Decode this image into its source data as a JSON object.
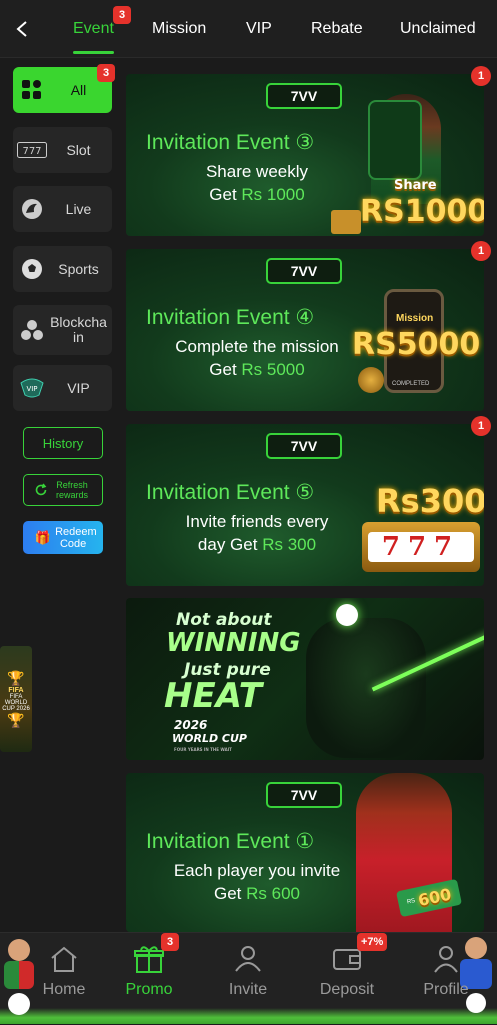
{
  "header": {
    "tabs": [
      {
        "label": "Event",
        "badge": "3",
        "active": true
      },
      {
        "label": "Mission"
      },
      {
        "label": "VIP"
      },
      {
        "label": "Rebate"
      },
      {
        "label": "Unclaimed"
      }
    ]
  },
  "sidebar": {
    "categories": [
      {
        "label": "All",
        "icon": "grid-icon",
        "badge": "3",
        "active": true
      },
      {
        "label": "Slot",
        "icon": "slot-777-icon"
      },
      {
        "label": "Live",
        "icon": "live-dealer-icon"
      },
      {
        "label": "Sports",
        "icon": "soccer-ball-icon"
      },
      {
        "label": "Blockchain",
        "icon": "blockchain-icon"
      },
      {
        "label": "VIP",
        "icon": "vip-crest-icon"
      }
    ],
    "history_label": "History",
    "refresh_label": "Refresh rewards",
    "redeem_label": "Redeem Code",
    "fifa_promo": {
      "line1": "FIFA",
      "line2": "FIFA WORLD CUP 2026"
    }
  },
  "banners": [
    {
      "brand": "7VV",
      "title": "Invitation Event ③",
      "line1": "Share weekly",
      "line2_prefix": "Get ",
      "line2_amount": "Rs 1000",
      "art_top": "Share",
      "art_text": "RS1000",
      "badge": "1"
    },
    {
      "brand": "7VV",
      "title": "Invitation Event ④",
      "line1": "Complete the mission",
      "line2_prefix": "Get ",
      "line2_amount": "Rs 5000",
      "art_top": "Mission",
      "art_sub": "COMPLETED",
      "art_text": "RS5000",
      "badge": "1"
    },
    {
      "brand": "7VV",
      "title": "Invitation Event ⑤",
      "line1": "Invite friends every",
      "line2_prefix": "day Get ",
      "line2_amount": "Rs 300",
      "art_text": "Rs300",
      "art_reels": "777",
      "badge": "1"
    },
    {
      "brand": "7VV",
      "title": "Invitation Event ①",
      "line1": "Each player you invite",
      "line2_prefix": "Get ",
      "line2_amount": "Rs 600",
      "art_text": "600",
      "art_small": "RS"
    }
  ],
  "worldcup_banner": {
    "line1": "Not about",
    "line2": "WINNING",
    "line3": "Just pure",
    "line4": "HEAT",
    "line5": "2026",
    "line6": "WORLD CUP",
    "line7": "FOUR YEARS IN THE WAIT"
  },
  "bottom_nav": [
    {
      "label": "Home",
      "icon": "home-icon"
    },
    {
      "label": "Promo",
      "icon": "gift-icon",
      "badge": "3",
      "active": true
    },
    {
      "label": "Invite",
      "icon": "invite-users-icon"
    },
    {
      "label": "Deposit",
      "icon": "wallet-icon",
      "badge": "+7%"
    },
    {
      "label": "Profile",
      "icon": "profile-icon"
    }
  ],
  "colors": {
    "accent": "#38d33a",
    "badge": "#e5322b",
    "background": "#1b1b1b",
    "gold": "#ffd75e"
  }
}
